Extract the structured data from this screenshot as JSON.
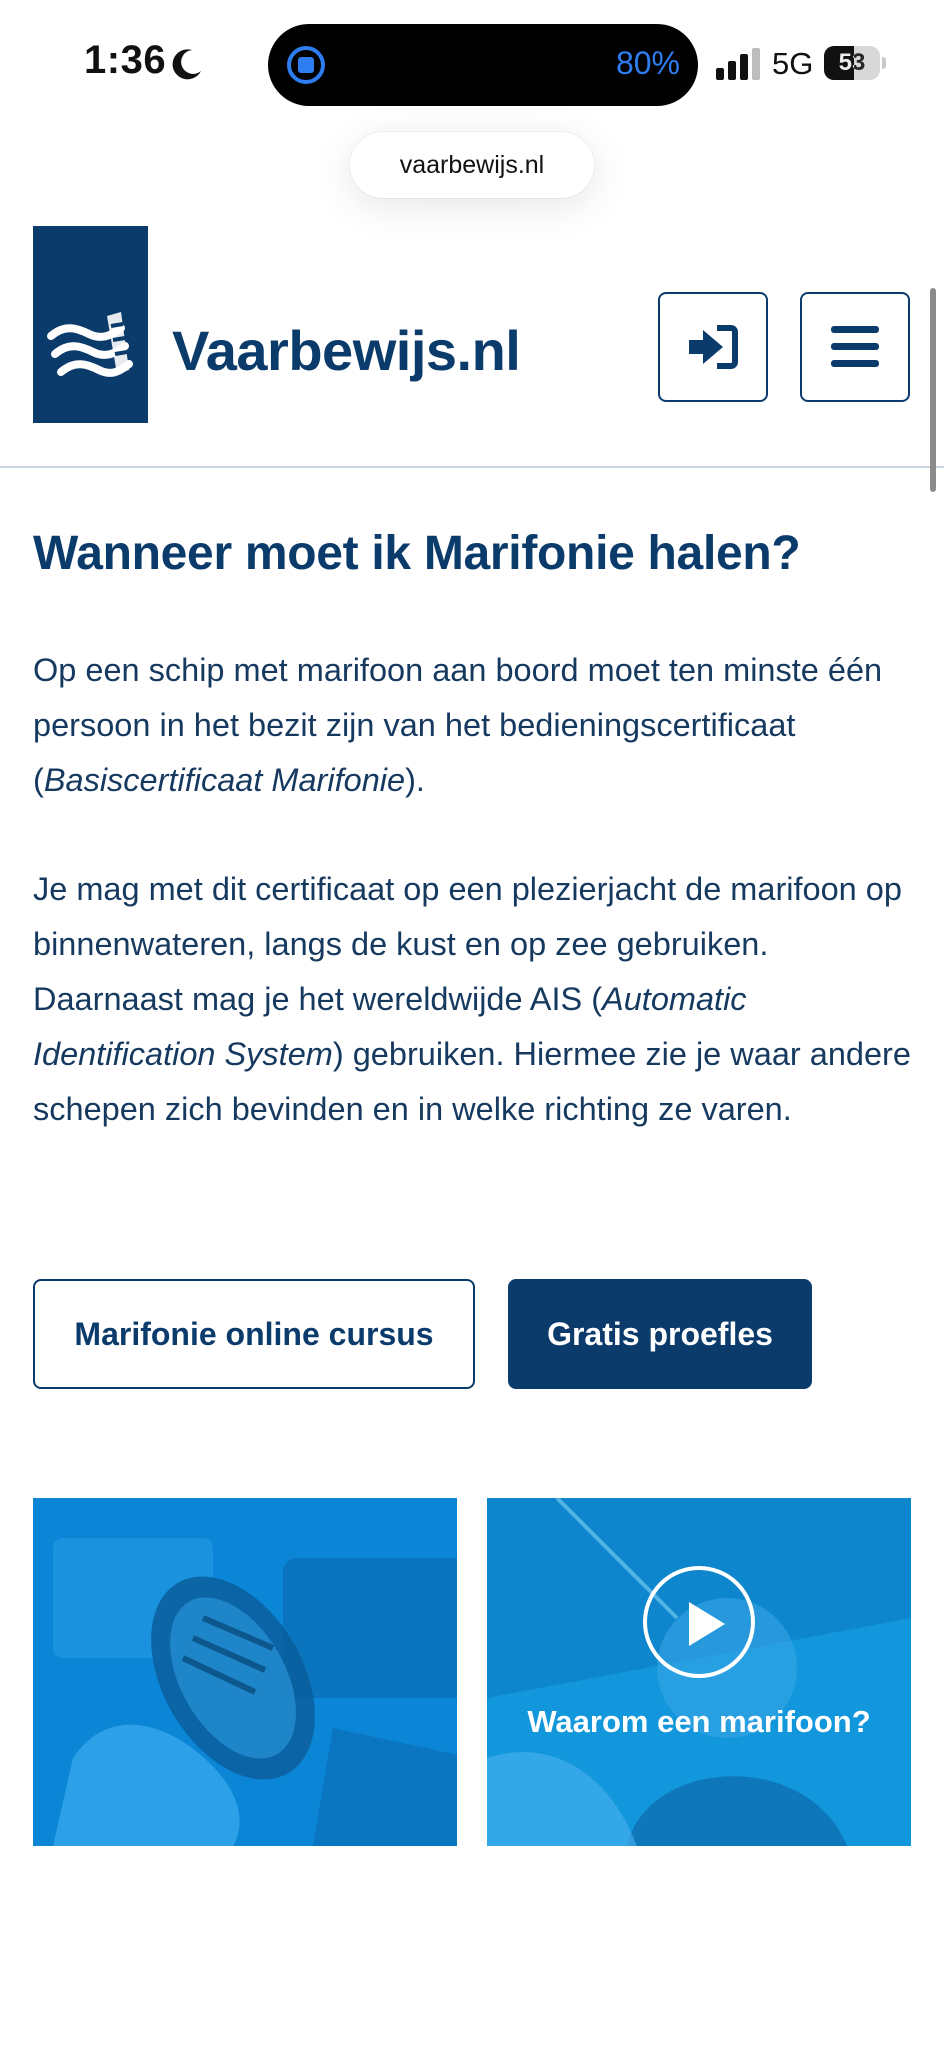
{
  "status_bar": {
    "time": "1:36",
    "island_percent": "80%",
    "network": "5G",
    "battery": "53",
    "battery_level": 0.53
  },
  "browser": {
    "url": "vaarbewijs.nl"
  },
  "header": {
    "brand": "Vaarbewijs.nl",
    "login_icon": "login-icon",
    "menu_icon": "hamburger-menu-icon"
  },
  "content": {
    "heading": "Wanneer moet ik Marifonie halen?",
    "p1_text": "Op een schip met marifoon aan boord moet ten minste één persoon in het bezit zijn van het bedieningscertificaat (",
    "p1_em": "Basiscertificaat Marifonie",
    "p1_end": ").",
    "p2_text": "Je mag met dit certificaat op een plezierjacht de marifoon op binnenwateren, langs de kust en op zee gebruiken. Daarnaast mag je het wereldwijde AIS (",
    "p2_em": "Automatic Identification System",
    "p2_end": ") gebruiken. Hiermee zie je waar andere schepen zich bevinden en in welke richting ze varen."
  },
  "buttons": {
    "online_course": "Marifonie online cursus",
    "free_lesson": "Gratis proefles"
  },
  "cards": {
    "video_caption": "Waarom een marifoon?"
  },
  "colors": {
    "brand_navy": "#0b3b6b",
    "accent_blue": "#0c7fcf",
    "island_text": "#2e7df0"
  }
}
